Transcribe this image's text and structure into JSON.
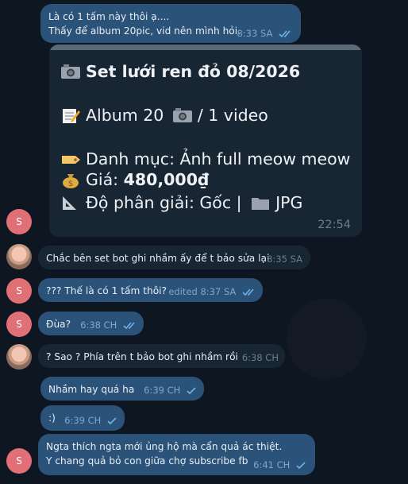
{
  "messages": {
    "m1": {
      "line1": "Là có 1 tấm này thôi ạ....",
      "line2": "Thấy để album 20pic, vid nên mình hỏi.",
      "time": "8:33 SA"
    },
    "post": {
      "title": "Set lưới ren đỏ 08/2026",
      "album": "Album 20",
      "album_suffix": "/ 1 video",
      "category": "Danh mục: Ảnh full meow meow",
      "price_label": "Giá:",
      "price_value": "480,000₫",
      "resolution": "Độ phân giải: Gốc |",
      "format": "JPG",
      "time": "22:54"
    },
    "m2": {
      "text": "Chắc bên set bot ghi nhầm ấy để t bảo sửa lại",
      "time": "8:35 SA"
    },
    "m3": {
      "text": "??? Thế là có 1 tấm thôi?",
      "time": "edited 8:37 SA"
    },
    "m4": {
      "text": "Đùa?",
      "time": "6:38 CH"
    },
    "m5": {
      "text": "? Sao ? Phía trên t bảo bot ghi nhầm rồi",
      "time": "6:38 CH"
    },
    "m6": {
      "text": "Nhầm hay quá ha",
      "time": "6:39 CH"
    },
    "m7": {
      "text": ":)",
      "time": "6:39 CH"
    },
    "m8": {
      "line1": "Ngta thích ngta mới ủng hộ mà cẩn quả ác thiệt.",
      "line2": "Y chang quả bỏ con giữa chợ subscribe fb",
      "time": "6:41 CH"
    }
  },
  "avatar_letter": "S",
  "colors": {
    "background": "#0e1621",
    "outgoing": "#2b5278",
    "incoming": "#182533",
    "avatar": "#e17076",
    "check": "#6cb4ee"
  }
}
